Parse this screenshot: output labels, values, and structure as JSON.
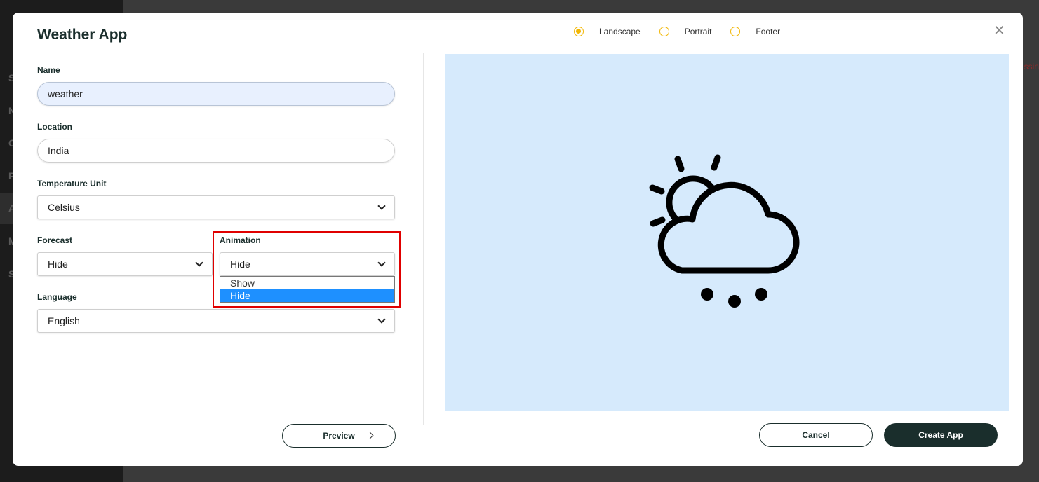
{
  "modal": {
    "title": "Weather App",
    "orientation": {
      "options": [
        "Landscape",
        "Portrait",
        "Footer"
      ],
      "selected": "Landscape"
    },
    "form": {
      "name": {
        "label": "Name",
        "value": "weather"
      },
      "location": {
        "label": "Location",
        "value": "India"
      },
      "temperature_unit": {
        "label": "Temperature Unit",
        "value": "Celsius"
      },
      "forecast": {
        "label": "Forecast",
        "value": "Hide"
      },
      "animation": {
        "label": "Animation",
        "value": "Hide",
        "options": [
          "Show",
          "Hide"
        ],
        "highlighted_option": "Hide"
      },
      "language": {
        "label": "Language",
        "value": "English"
      }
    },
    "preview_icon": "partly-cloudy-rain-icon",
    "buttons": {
      "preview": "Preview",
      "cancel": "Cancel",
      "create": "Create App"
    }
  },
  "colors": {
    "accent_radio": "#f2b705",
    "primary_dark": "#1a2e2c",
    "preview_bg": "#d6eafc",
    "highlight_border": "#e00000",
    "selected_option": "#1e90ff"
  }
}
